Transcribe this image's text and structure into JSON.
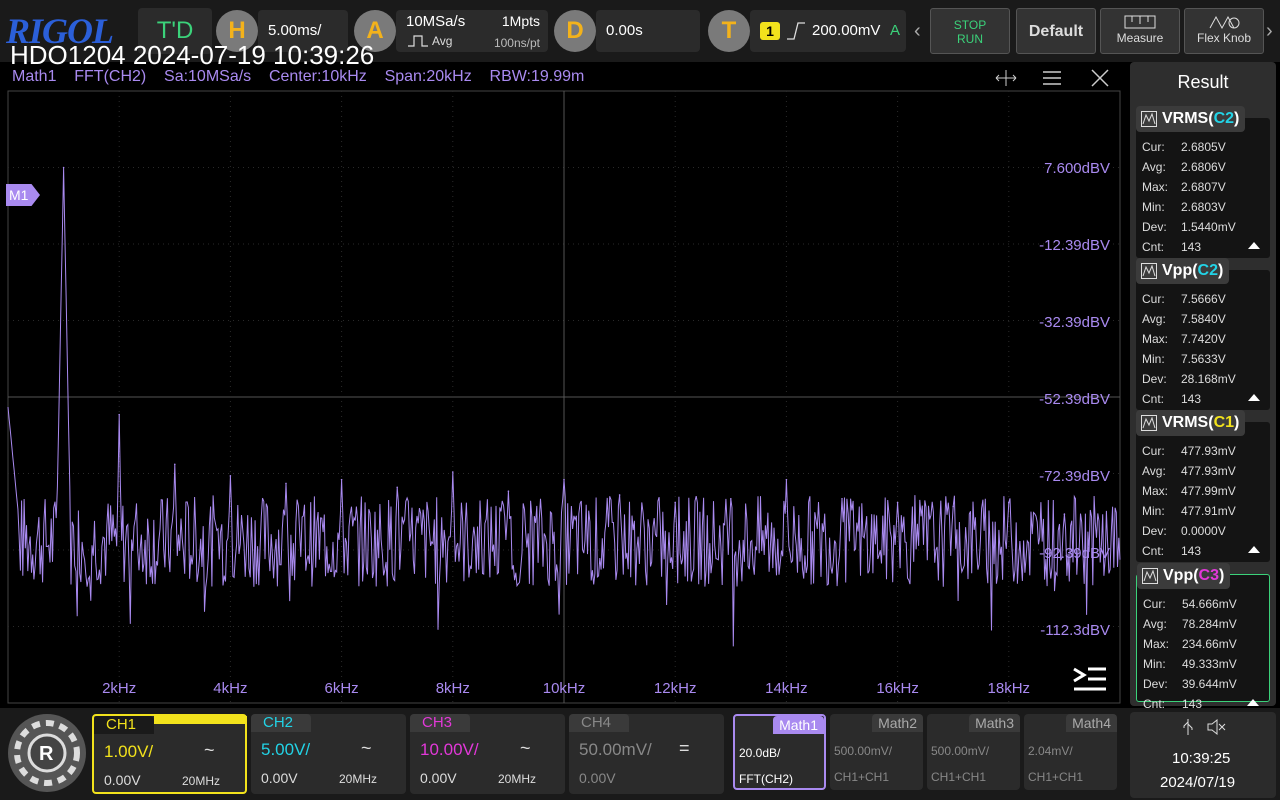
{
  "topbar": {
    "logo": "RIGOL",
    "trigger_mode": "T'D",
    "horizontal": {
      "letter": "H",
      "timebase": "5.00ms/"
    },
    "acquire": {
      "letter": "A",
      "sample_rate": "10MSa/s",
      "mode": "Avg",
      "depth": "1Mpts",
      "interval": "100ns/pt"
    },
    "delay": {
      "letter": "D",
      "value": "0.00s"
    },
    "trigger": {
      "letter": "T",
      "source": "1",
      "level": "200.00mV",
      "mode": "A"
    },
    "buttons": {
      "stop": "STOP",
      "run": "RUN",
      "default": "Default",
      "measure": "Measure",
      "flex": "Flex Knob"
    },
    "overlay_title": "HDO1204 2024-07-19 10:39:26"
  },
  "math_header": {
    "name": "Math1",
    "op": "FFT(CH2)",
    "sa": "Sa:10MSa/s",
    "center": "Center:10kHz",
    "span": "Span:20kHz",
    "rbw": "RBW:19.99m"
  },
  "marker": "M1",
  "chart_data": {
    "type": "line",
    "y_tick_labels": [
      "7.600dBV",
      "-12.39dBV",
      "-32.39dBV",
      "-52.39dBV",
      "-72.39dBV",
      "-92.39dBV",
      "-112.3dBV"
    ],
    "x_tick_labels": [
      "2kHz",
      "4kHz",
      "6kHz",
      "8kHz",
      "10kHz",
      "12kHz",
      "14kHz",
      "16kHz",
      "18kHz"
    ],
    "xlim": [
      0,
      20000
    ],
    "ylim": [
      -132.39,
      27.61
    ],
    "peaks": [
      {
        "x": 1000,
        "y": 7.6
      },
      {
        "x": 2000,
        "y": -57
      },
      {
        "x": 3000,
        "y": -70
      },
      {
        "x": 4000,
        "y": -73
      },
      {
        "x": 5000,
        "y": -75
      },
      {
        "x": 6000,
        "y": -74
      },
      {
        "x": 7000,
        "y": -76
      },
      {
        "x": 8000,
        "y": -72
      },
      {
        "x": 9000,
        "y": -77
      },
      {
        "x": 10000,
        "y": -74
      },
      {
        "x": 11000,
        "y": -78
      },
      {
        "x": 12000,
        "y": -80
      },
      {
        "x": 13000,
        "y": -79
      },
      {
        "x": 14000,
        "y": -74
      },
      {
        "x": 15000,
        "y": -79
      },
      {
        "x": 16000,
        "y": -80
      },
      {
        "x": 17000,
        "y": -81
      },
      {
        "x": 18000,
        "y": -80
      },
      {
        "x": 19000,
        "y": -83
      }
    ],
    "noise_floor": -90,
    "color": "#a98af0"
  },
  "result": {
    "title": "Result",
    "measurements": [
      {
        "name": "VRMS",
        "ch": "C2",
        "chcolor": "#22d3e6",
        "cur": "2.6805V",
        "avg": "2.6806V",
        "max": "2.6807V",
        "min": "2.6803V",
        "dev": "1.5440mV",
        "cnt": "143"
      },
      {
        "name": "Vpp",
        "ch": "C2",
        "chcolor": "#22d3e6",
        "cur": "7.5666V",
        "avg": "7.5840V",
        "max": "7.7420V",
        "min": "7.5633V",
        "dev": "28.168mV",
        "cnt": "143"
      },
      {
        "name": "VRMS",
        "ch": "C1",
        "chcolor": "#f2e21c",
        "cur": "477.93mV",
        "avg": "477.93mV",
        "max": "477.99mV",
        "min": "477.91mV",
        "dev": "0.0000V",
        "cnt": "143"
      },
      {
        "name": "Vpp",
        "ch": "C3",
        "chcolor": "#e238d8",
        "cur": "54.666mV",
        "avg": "78.284mV",
        "max": "234.66mV",
        "min": "49.333mV",
        "dev": "39.644mV",
        "cnt": "143"
      }
    ],
    "row_labels": {
      "cur": "Cur:",
      "avg": "Avg:",
      "max": "Max:",
      "min": "Min:",
      "dev": "Dev:",
      "cnt": "Cnt:"
    }
  },
  "channels": [
    {
      "name": "CH1",
      "scale": "1.00V/",
      "offset": "0.00V",
      "coupling": "~",
      "bw": "20MHz",
      "color": "#f2e21c"
    },
    {
      "name": "CH2",
      "scale": "5.00V/",
      "offset": "0.00V",
      "coupling": "~",
      "bw": "20MHz",
      "color": "#22d3e6"
    },
    {
      "name": "CH3",
      "scale": "10.00V/",
      "offset": "0.00V",
      "coupling": "~",
      "bw": "20MHz",
      "color": "#e238d8"
    },
    {
      "name": "CH4",
      "scale": "50.00mV/",
      "offset": "0.00V",
      "coupling": "=",
      "bw": "",
      "color": "#888888"
    }
  ],
  "maths": [
    {
      "name": "Math1",
      "scale": "20.0dB/",
      "op": "FFT(CH2)"
    },
    {
      "name": "Math2",
      "scale": "500.00mV/",
      "op": "CH1+CH1"
    },
    {
      "name": "Math3",
      "scale": "500.00mV/",
      "op": "CH1+CH1"
    },
    {
      "name": "Math4",
      "scale": "2.04mV/",
      "op": "CH1+CH1"
    }
  ],
  "clock": {
    "time": "10:39:25",
    "date": "2024/07/19"
  }
}
